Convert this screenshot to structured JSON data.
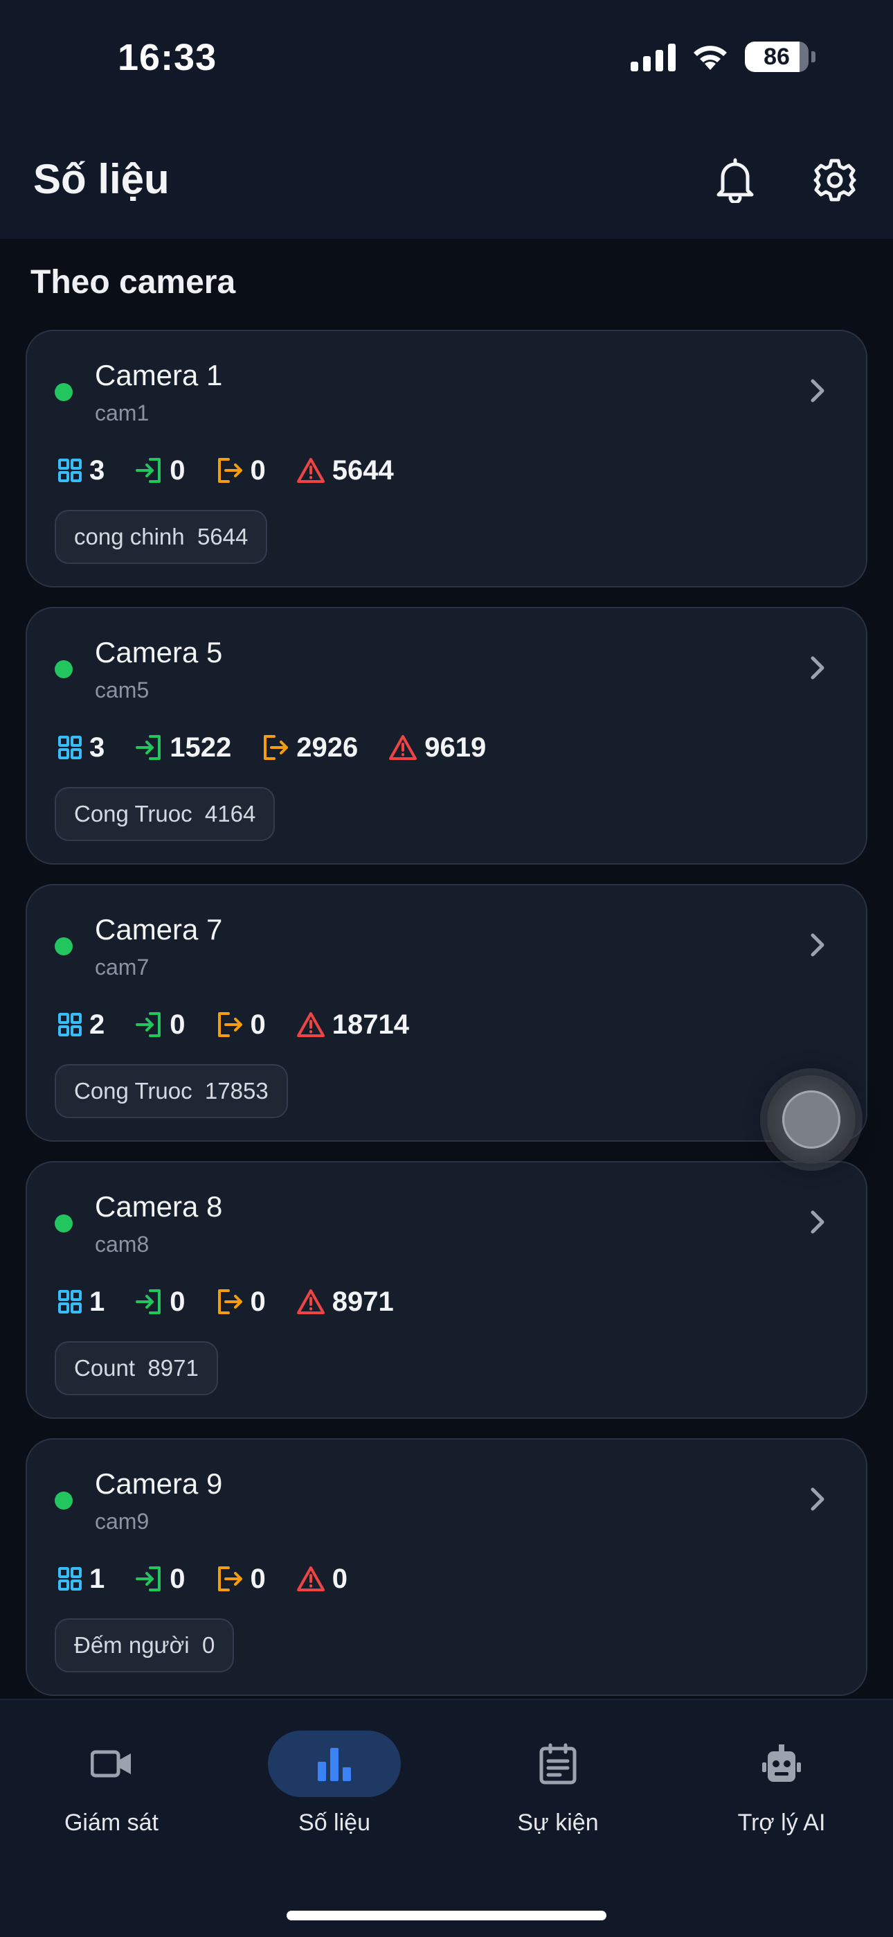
{
  "status": {
    "time": "16:33",
    "battery": "86",
    "battery_level": 0.86
  },
  "header": {
    "title": "Số liệu"
  },
  "section": {
    "title": "Theo camera"
  },
  "cameras": [
    {
      "name": "Camera 1",
      "id": "cam1",
      "zones": "3",
      "in": "0",
      "out": "0",
      "alerts": "5644",
      "tag": "cong chinh  5644"
    },
    {
      "name": "Camera 5",
      "id": "cam5",
      "zones": "3",
      "in": "1522",
      "out": "2926",
      "alerts": "9619",
      "tag": "Cong Truoc  4164"
    },
    {
      "name": "Camera 7",
      "id": "cam7",
      "zones": "2",
      "in": "0",
      "out": "0",
      "alerts": "18714",
      "tag": "Cong Truoc  17853"
    },
    {
      "name": "Camera 8",
      "id": "cam8",
      "zones": "1",
      "in": "0",
      "out": "0",
      "alerts": "8971",
      "tag": "Count  8971"
    },
    {
      "name": "Camera 9",
      "id": "cam9",
      "zones": "1",
      "in": "0",
      "out": "0",
      "alerts": "0",
      "tag": "Đếm người  0"
    }
  ],
  "nav": [
    {
      "label": "Giám sát",
      "icon": "video-camera-icon"
    },
    {
      "label": "Số liệu",
      "icon": "bar-chart-icon",
      "active": true
    },
    {
      "label": "Sự kiện",
      "icon": "calendar-list-icon"
    },
    {
      "label": "Trợ lý AI",
      "icon": "robot-icon"
    }
  ],
  "colors": {
    "background": "#0a0e17",
    "card": "#161d2b",
    "online": "#22c55e",
    "zone": "#38bdf8",
    "in": "#22c55e",
    "out": "#f59e0b",
    "alert": "#ef4444",
    "nav_active": "#3b82f6"
  }
}
